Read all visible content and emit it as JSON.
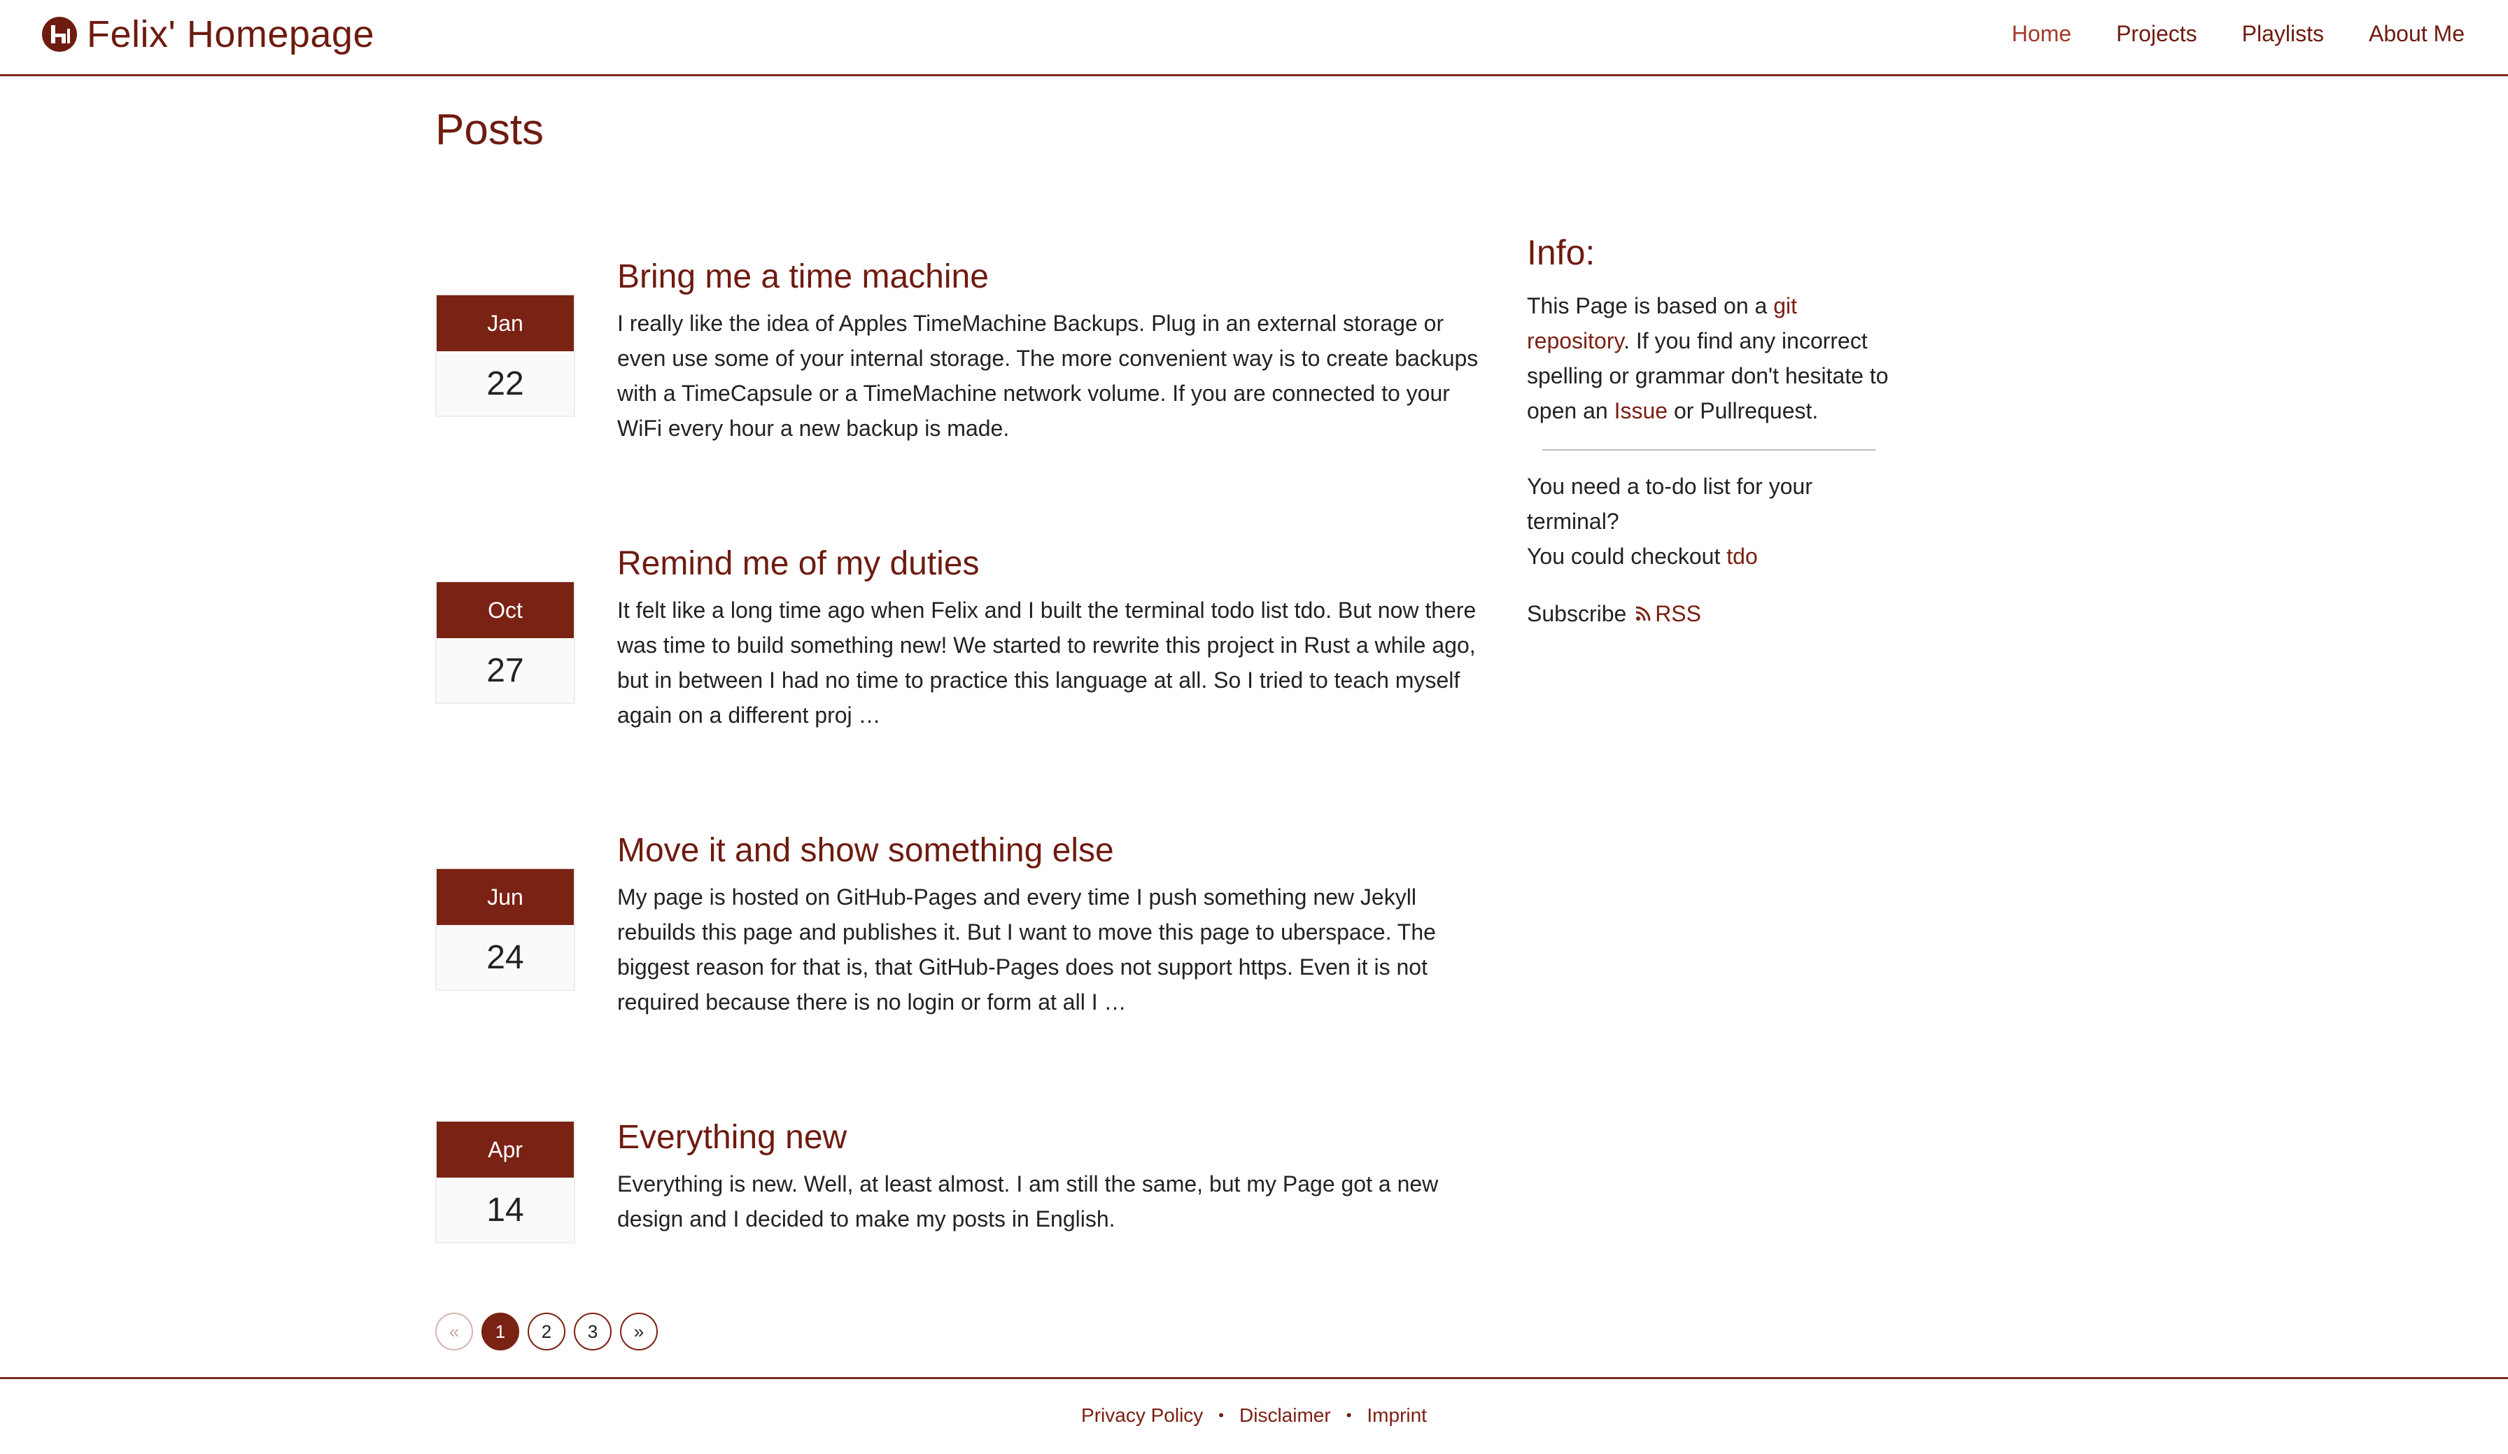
{
  "header": {
    "site_title": "Felix' Homepage",
    "nav": [
      {
        "label": "Home",
        "active": true
      },
      {
        "label": "Projects",
        "active": false
      },
      {
        "label": "Playlists",
        "active": false
      },
      {
        "label": "About Me",
        "active": false
      }
    ]
  },
  "main": {
    "title": "Posts",
    "posts": [
      {
        "month": "Jan",
        "day": "22",
        "title": "Bring me a time machine",
        "excerpt": "I really like the idea of Apples TimeMachine Backups. Plug in an external storage or even use some of your internal storage. The more convenient way is to create backups with a TimeCapsule or a TimeMachine network volume. If you are connected to your WiFi every hour a new backup is made."
      },
      {
        "month": "Oct",
        "day": "27",
        "title": "Remind me of my duties",
        "excerpt": "It felt like a long time ago when Felix and I built the terminal todo list tdo. But now there was time to build something new! We started to rewrite this project in Rust a while ago, but in between I had no time to practice this language at all. So I tried to teach myself again on a different proj …"
      },
      {
        "month": "Jun",
        "day": "24",
        "title": "Move it and show something else",
        "excerpt": "My page is hosted on GitHub-Pages and every time I push something new Jekyll rebuilds this page and publishes it. But I want to move this page to uberspace. The biggest reason for that is, that GitHub-Pages does not support https. Even it is not required because there is no login or form at all I …"
      },
      {
        "month": "Apr",
        "day": "14",
        "title": "Everything new",
        "excerpt": "Everything is new. Well, at least almost. I am still the same, but my Page got a new design and I decided to make my posts in English."
      }
    ]
  },
  "sidebar": {
    "title": "Info:",
    "info_text_1": "This Page is based on a ",
    "info_link_1": "git repository",
    "info_text_2": ". If you find any incorrect spelling or grammar don't hesitate to open an ",
    "info_link_2": "Issue",
    "info_text_3": " or Pullrequest.",
    "todo_text": "You need a to-do list for your terminal?",
    "checkout_text": "You could checkout ",
    "checkout_link": "tdo",
    "subscribe_text": "Subscribe",
    "rss_label": "RSS"
  },
  "pagination": {
    "prev": "«",
    "pages": [
      "1",
      "2",
      "3"
    ],
    "current": "1",
    "next": "»"
  },
  "footer": {
    "links": [
      "Privacy Policy",
      "Disclaimer",
      "Imprint"
    ],
    "separator": "•"
  },
  "colors": {
    "accent": "#7a2214",
    "link": "#6e1b10",
    "nav_active": "#a23a2a"
  }
}
